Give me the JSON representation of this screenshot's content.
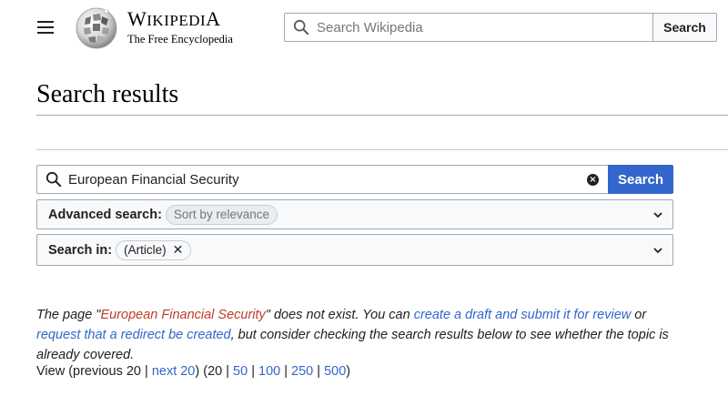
{
  "header": {
    "wordmark_title": "Wikipedia",
    "wordmark_tagline": "The Free Encyclopedia",
    "search_placeholder": "Search Wikipedia",
    "search_button": "Search"
  },
  "page": {
    "title": "Search results"
  },
  "search_form": {
    "query": "European Financial Security",
    "button": "Search",
    "advanced_label": "Advanced search:",
    "advanced_chip": "Sort by relevance",
    "search_in_label": "Search in:",
    "search_in_chip": "(Article)"
  },
  "notice": {
    "part1": "The page \"",
    "missing_title": "European Financial Security",
    "part2": "\" does not exist. You can ",
    "link_create": "create a draft and submit it for review",
    "part3": " or ",
    "link_redirect": "request that a redirect be created",
    "part4": ", but consider checking the search results below to see whether the topic is already covered."
  },
  "pagination": {
    "view": "View (previous 20 | ",
    "next": "next 20",
    "close_paren": ") (",
    "sizes": [
      "20",
      "50",
      "100",
      "250",
      "500"
    ],
    "end": ")"
  },
  "colors": {
    "link": "#3366cc",
    "missing_link": "#bf3c2c",
    "primary_button": "#3366cc"
  }
}
